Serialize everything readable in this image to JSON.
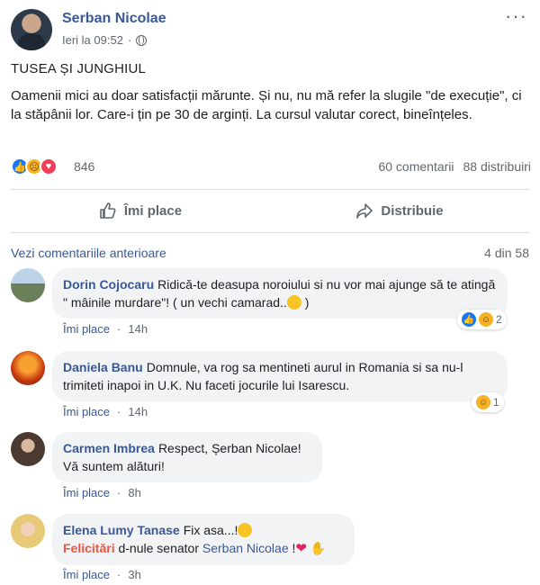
{
  "post": {
    "author": "Serban Nicolae",
    "timestamp": "Ieri la 09:52",
    "title": "TUSEA ȘI JUNGHIUL",
    "body": "Oamenii mici au doar satisfacții mărunte. Și nu, nu mă refer la slugile \"de execuție\", ci la stăpânii lor. Care-i țin pe 30 de arginți. La cursul valutar corect, bineînțeles.",
    "reaction_count": "846",
    "comments_count": "60 comentarii",
    "shares_count": "88 distribuiri",
    "reactions": [
      "like",
      "sad",
      "love"
    ]
  },
  "actions": {
    "like_label": "Îmi place",
    "share_label": "Distribuie"
  },
  "comments_section": {
    "view_previous": "Vezi comentariile anterioare",
    "pagination": "4 din 58"
  },
  "comments": [
    {
      "name": "Dorin Cojocaru",
      "text": "Ridică-te deasupa noroiului si nu vor mai ajunge să te atingă \" mâinile murdare\"! ( un vechi camarad..",
      "like_label": "Îmi place",
      "time": "14h",
      "reaction_count": "2"
    },
    {
      "name": "Daniela Banu",
      "text": "Domnule, va rog sa mentineti aurul in Romania si sa nu-l trimiteti inapoi in U.K. Nu faceti jocurile lui Isarescu.",
      "like_label": "Îmi place",
      "time": "14h",
      "reaction_count": "1"
    },
    {
      "name": "Carmen Imbrea",
      "text": "Respect, Șerban Nicolae!",
      "text2": "Vă suntem alături!",
      "like_label": "Îmi place",
      "time": "8h"
    },
    {
      "name": "Elena Lumy Tanase",
      "text": "Fix asa...!",
      "text2_highlight": "Felicitări",
      "text2": " d-nule senator ",
      "mention": "Serban Nicolae",
      "text2_end": " !",
      "like_label": "Îmi place",
      "time": "3h"
    }
  ],
  "colors": {
    "link": "#385898",
    "muted": "#606770",
    "bubble": "#f2f3f5",
    "divider": "#dadde1",
    "like_blue": "#1877f2",
    "love_red": "#f33e58",
    "orange": "#f5533d"
  },
  "icons": [
    "more-icon",
    "globe-icon",
    "thumbs-up-icon",
    "share-arrow-icon",
    "like-reaction-icon",
    "sad-reaction-icon",
    "love-reaction-icon",
    "haha-reaction-icon",
    "heart-emoji",
    "clap-emoji"
  ]
}
